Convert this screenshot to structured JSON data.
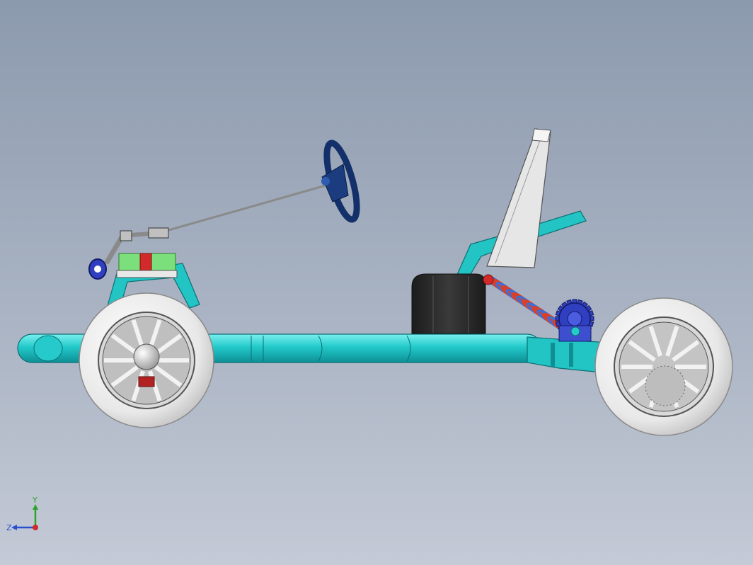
{
  "view": {
    "background_top": "#8c9aae",
    "background_bottom": "#c4cad6"
  },
  "model": {
    "frame_color": "#1fc6c6",
    "tire_color": "#efefef",
    "steering_wheel_color": "#14306a",
    "seat_color": "#2b2b2b",
    "spring_colors": [
      "#3b6fd8",
      "#d8402a"
    ],
    "gear_color": "#2f3fbf",
    "accent_red": "#d22a2a",
    "accent_green": "#7be07b"
  },
  "triad": {
    "y_label": "Y",
    "z_label": "Z",
    "y_color": "#2aa52a",
    "z_color": "#2a4fd0",
    "x_color": "#d02a2a"
  }
}
